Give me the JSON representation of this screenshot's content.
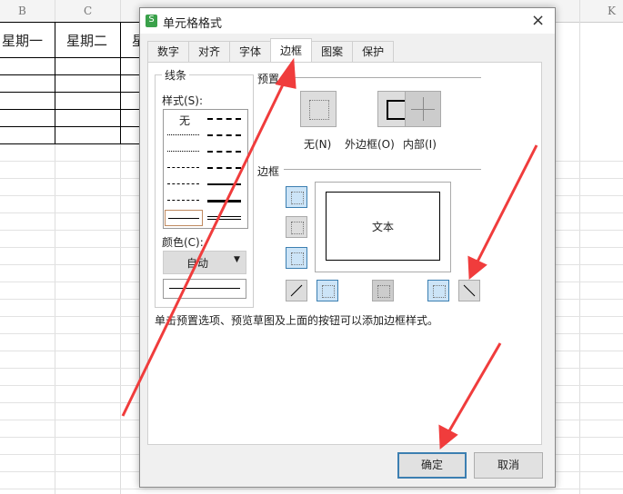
{
  "sheet": {
    "columns": [
      "B",
      "C",
      "K"
    ],
    "cells": [
      "星期一",
      "星期二",
      "星"
    ]
  },
  "dialog": {
    "title": "单元格格式",
    "app_icon": "S",
    "tabs": [
      "数字",
      "对齐",
      "字体",
      "边框",
      "图案",
      "保护"
    ],
    "active_tab": "边框",
    "line_group": "线条",
    "style_label": "样式(S):",
    "style_none": "无",
    "color_label": "颜色(C):",
    "color_value": "自动",
    "preset_group": "预置",
    "presets": [
      "无(N)",
      "外边框(O)",
      "内部(I)"
    ],
    "border_group": "边框",
    "preview_text": "文本",
    "hint": "单击预置选项、预览草图及上面的按钮可以添加边框样式。",
    "ok": "确定",
    "cancel": "取消",
    "close_icon": "×"
  },
  "colors": {
    "accent": "#3c7fb1",
    "arrow": "#f03c3c",
    "active_btn": "#cce4f7"
  }
}
